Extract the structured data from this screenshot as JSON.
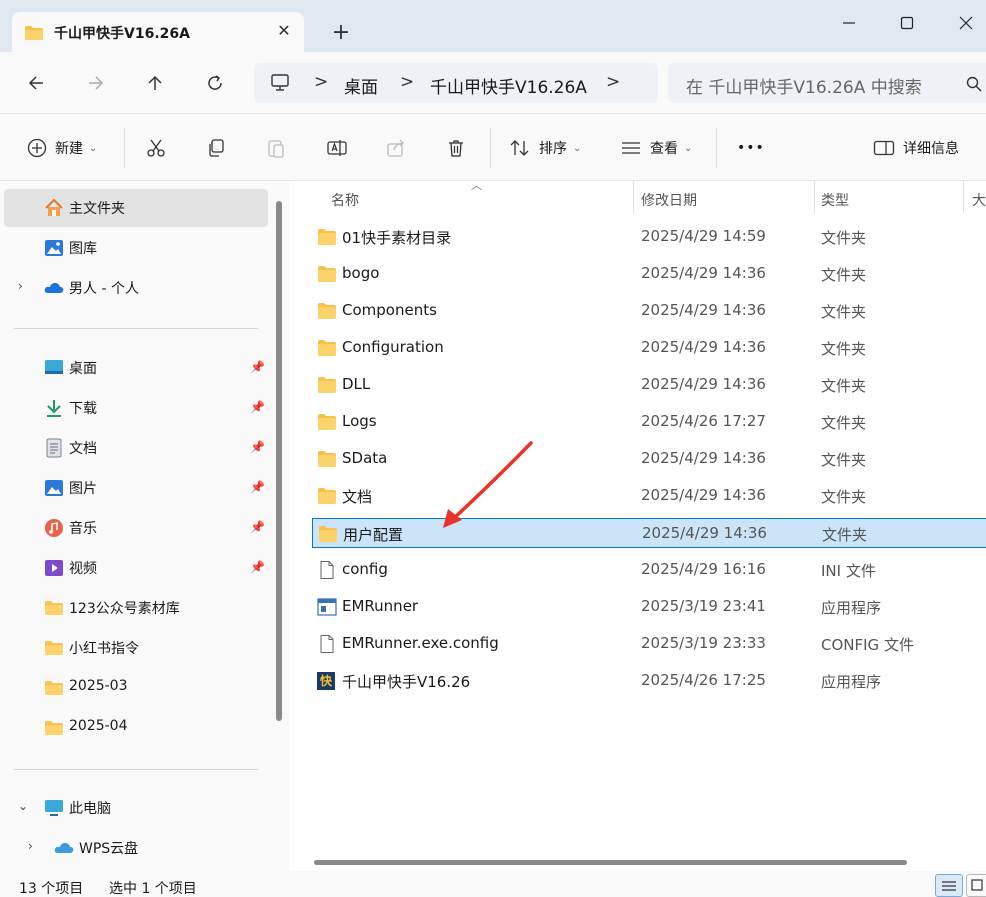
{
  "window": {
    "tab_title": "千山甲快手V16.26A",
    "tab_close_icon": "close-icon",
    "new_tab_symbol": "+",
    "controls": [
      "minimize-icon",
      "maximize-icon",
      "close-icon"
    ]
  },
  "nav": {
    "back_icon": "arrow-left-icon",
    "forward_icon": "arrow-right-icon",
    "up_icon": "arrow-up-icon",
    "refresh_icon": "refresh-icon",
    "breadcrumb": [
      "桌面",
      "千山甲快手V16.26A"
    ],
    "breadcrumb_sep": ">",
    "search_placeholder": "在 千山甲快手V16.26A 中搜索"
  },
  "toolbar": {
    "new_label": "新建",
    "sort_label": "排序",
    "view_label": "查看",
    "more_label": "•••",
    "details_label": "详细信息",
    "icons": [
      "cut-icon",
      "copy-icon",
      "paste-icon",
      "rename-icon",
      "share-icon",
      "delete-icon"
    ]
  },
  "sidebar": {
    "top": [
      {
        "label": "主文件夹",
        "icon": "home-icon",
        "selected": true
      },
      {
        "label": "图库",
        "icon": "gallery-icon"
      },
      {
        "label": "男人 - 个人",
        "icon": "onedrive-icon",
        "expandable": true
      }
    ],
    "quick": [
      {
        "label": "桌面",
        "icon": "desktop-icon",
        "pinned": true
      },
      {
        "label": "下载",
        "icon": "download-icon",
        "pinned": true
      },
      {
        "label": "文档",
        "icon": "document-icon",
        "pinned": true
      },
      {
        "label": "图片",
        "icon": "pictures-icon",
        "pinned": true
      },
      {
        "label": "音乐",
        "icon": "music-icon",
        "pinned": true
      },
      {
        "label": "视频",
        "icon": "video-icon",
        "pinned": true
      },
      {
        "label": "123公众号素材库",
        "icon": "folder-icon"
      },
      {
        "label": "小红书指令",
        "icon": "folder-icon"
      },
      {
        "label": "2025-03",
        "icon": "folder-icon"
      },
      {
        "label": "2025-04",
        "icon": "folder-icon"
      }
    ],
    "devices": [
      {
        "label": "此电脑",
        "icon": "computer-icon",
        "expanded": true
      },
      {
        "label": "WPS云盘",
        "icon": "cloud-icon",
        "expandable": true
      }
    ]
  },
  "columns": {
    "name": "名称",
    "date": "修改日期",
    "type": "类型",
    "size": "大"
  },
  "files": [
    {
      "name": "01快手素材目录",
      "date": "2025/4/29 14:59",
      "type": "文件夹",
      "icon": "folder-icon"
    },
    {
      "name": "bogo",
      "date": "2025/4/29 14:36",
      "type": "文件夹",
      "icon": "folder-icon"
    },
    {
      "name": "Components",
      "date": "2025/4/29 14:36",
      "type": "文件夹",
      "icon": "folder-icon"
    },
    {
      "name": "Configuration",
      "date": "2025/4/29 14:36",
      "type": "文件夹",
      "icon": "folder-icon"
    },
    {
      "name": "DLL",
      "date": "2025/4/29 14:36",
      "type": "文件夹",
      "icon": "folder-icon"
    },
    {
      "name": "Logs",
      "date": "2025/4/26 17:27",
      "type": "文件夹",
      "icon": "folder-icon"
    },
    {
      "name": "SData",
      "date": "2025/4/29 14:36",
      "type": "文件夹",
      "icon": "folder-icon"
    },
    {
      "name": "文档",
      "date": "2025/4/29 14:36",
      "type": "文件夹",
      "icon": "folder-icon"
    },
    {
      "name": "用户配置",
      "date": "2025/4/29 14:36",
      "type": "文件夹",
      "icon": "folder-icon",
      "selected": true
    },
    {
      "name": "config",
      "date": "2025/4/29 16:16",
      "type": "INI 文件",
      "icon": "file-icon"
    },
    {
      "name": "EMRunner",
      "date": "2025/3/19 23:41",
      "type": "应用程序",
      "icon": "app-icon"
    },
    {
      "name": "EMRunner.exe.config",
      "date": "2025/3/19 23:33",
      "type": "CONFIG 文件",
      "icon": "file-icon"
    },
    {
      "name": "千山甲快手V16.26",
      "date": "2025/4/26 17:25",
      "type": "应用程序",
      "icon": "kuai-app-icon",
      "icon_text": "快"
    }
  ],
  "status": {
    "count": "13 个项目",
    "selected": "选中 1 个项目"
  },
  "colors": {
    "accent": "#0078d4",
    "selection": "#cce4f7",
    "folder": "#f8c24a",
    "annotation_arrow": "#e8322a"
  }
}
